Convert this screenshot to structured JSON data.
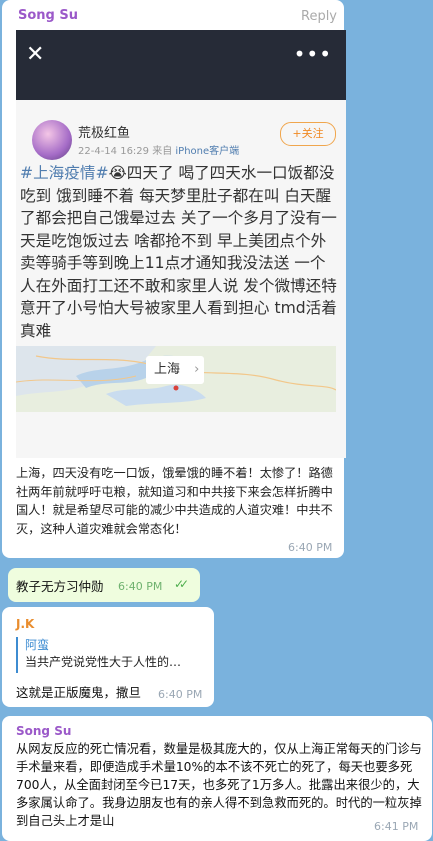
{
  "msg1": {
    "sender": "Song Su",
    "reply": "Reply",
    "weibo": {
      "close_icon": "close-icon",
      "more_icon": "more-icon",
      "username": "荒极红鱼",
      "date": "22-4-14 16:29",
      "from": "来自",
      "device": "iPhone客户端",
      "follow": "+关注",
      "hashtag": "#上海疫情#",
      "emoji": "😭",
      "text": "四天了 喝了四天水一口饭都没吃到 饿到睡不着 每天梦里肚子都在叫 白天醒了都会把自己饿晕过去 关了一个多月了没有一天是吃饱饭过去 啥都抢不到 早上美团点个外卖等骑手等到晚上11点才通知我没法送 一个人在外面打工还不敢和家里人说 发个微博还特意开了小号怕大号被家里人看到担心 tmd活着真难",
      "map_label": "上海",
      "map_chevron": "›"
    },
    "caption": "上海，四天没有吃一口饭，饿晕饿的睡不着！太惨了！路德社两年前就呼吁屯粮，就知道习和中共接下来会怎样折腾中国人！就是希望尽可能的减少中共造成的人道灾难！中共不灭，这种人道灾难就会常态化！",
    "time": "6:40 PM"
  },
  "msg2": {
    "text": "教子无方习仲勋",
    "time": "6:40 PM",
    "check": "✓✓"
  },
  "msg3": {
    "sender": "J.K",
    "quote_name": "阿蛮",
    "quote_text": "当共产党说党性大于人性的…",
    "text": "这就是正版魔鬼，撒旦",
    "time": "6:40 PM"
  },
  "msg4": {
    "sender": "Song Su",
    "text": "从网友反应的死亡情况看，数量是极其庞大的，仅从上海正常每天的门诊与手术量来看，即便造成手术量10%的本不该不死亡的死了，每天也要多死700人，从全面封闭至今已17天，也多死了1万多人。批露出来很少的，大多家属认命了。我身边朋友也有的亲人得不到急救而死的。时代的一粒灰掉到自己头上才是山",
    "time": "6:41 PM"
  }
}
